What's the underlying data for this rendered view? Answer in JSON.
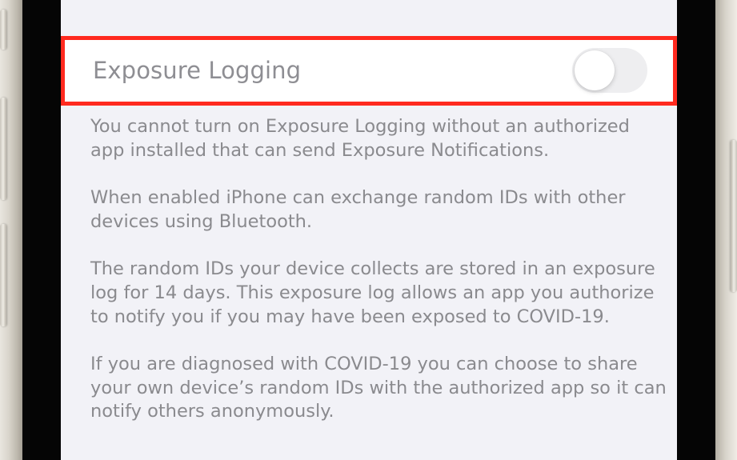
{
  "settings": {
    "exposure_logging_label": "Exposure Logging",
    "exposure_logging_enabled": false
  },
  "footer": {
    "paragraphs": [
      "You cannot turn on Exposure Logging without an authorized app installed that can send Exposure Notifications.",
      "When enabled iPhone can exchange random IDs with other devices using Bluetooth.",
      "The random IDs your device collects are stored in an exposure log for 14 days. This exposure log allows an app you authorize to notify you if you may have been exposed to COVID-19.",
      "If you are diagnosed with COVID-19 you can choose to share your own device’s random IDs with the authorized app so it can notify others anonymously."
    ]
  },
  "colors": {
    "highlight": "#ff2a1f",
    "background": "#f2f2f7",
    "row_background": "#ffffff",
    "secondary_text": "#8a8a8e"
  }
}
